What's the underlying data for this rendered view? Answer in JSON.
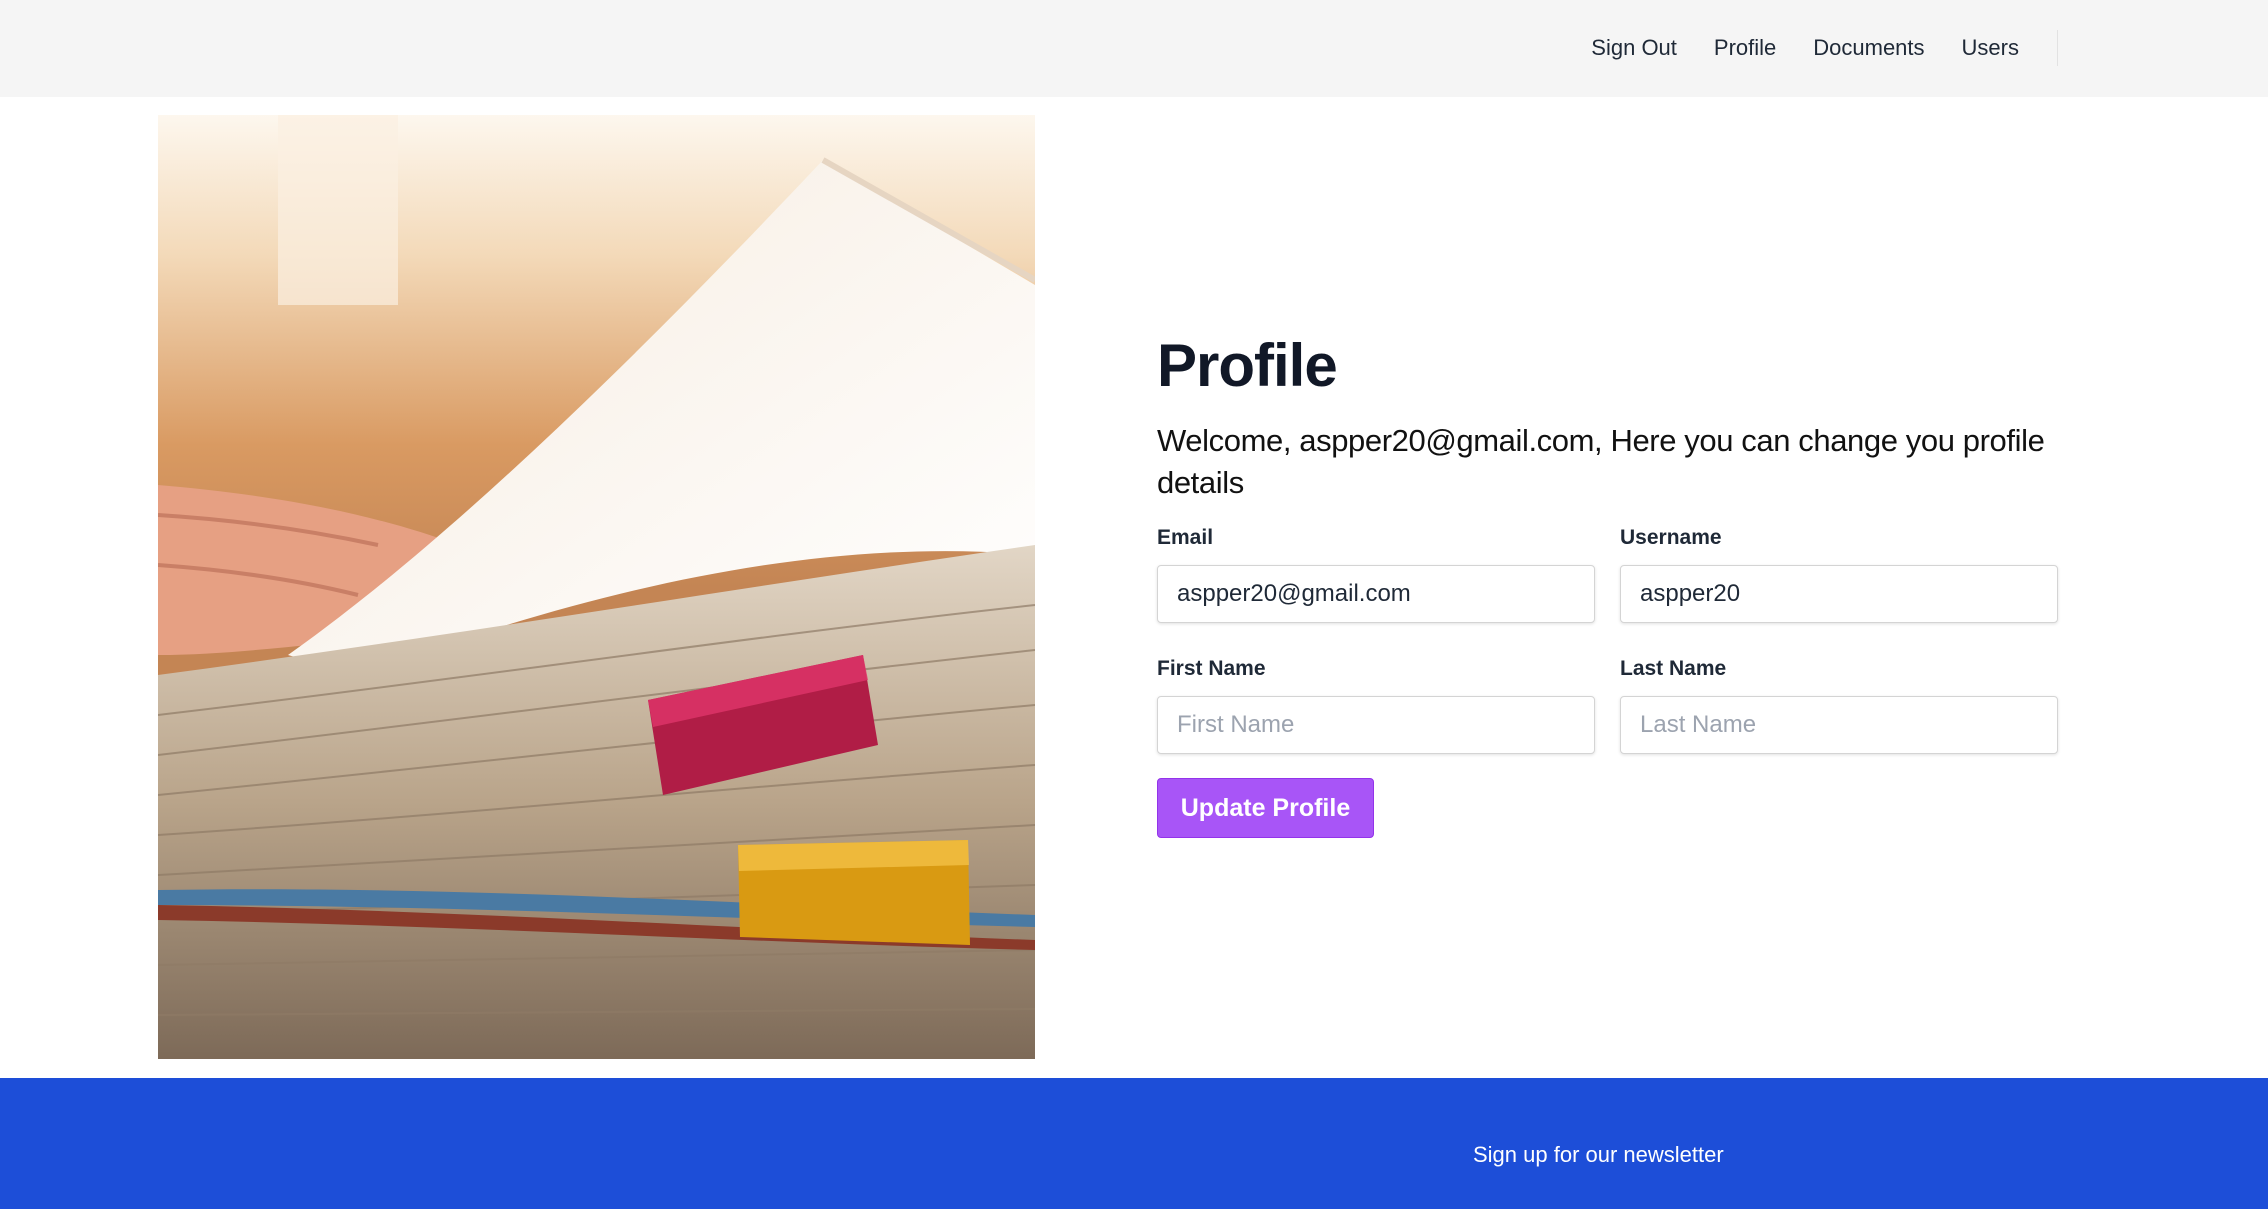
{
  "nav": {
    "items": [
      {
        "label": "Sign Out"
      },
      {
        "label": "Profile"
      },
      {
        "label": "Documents"
      },
      {
        "label": "Users"
      }
    ]
  },
  "main": {
    "title": "Profile",
    "welcome": "Welcome, aspper20@gmail.com, Here you can change you profile details",
    "form": {
      "email": {
        "label": "Email",
        "value": "aspper20@gmail.com"
      },
      "username": {
        "label": "Username",
        "value": "aspper20"
      },
      "first_name": {
        "label": "First Name",
        "placeholder": "First Name",
        "value": ""
      },
      "last_name": {
        "label": "Last Name",
        "placeholder": "Last Name",
        "value": ""
      },
      "submit_label": "Update Profile"
    }
  },
  "footer": {
    "newsletter": "Sign up for our newsletter"
  },
  "colors": {
    "header_bg": "#f5f5f5",
    "accent": "#a855f7",
    "footer_bg": "#1d4ed8"
  }
}
